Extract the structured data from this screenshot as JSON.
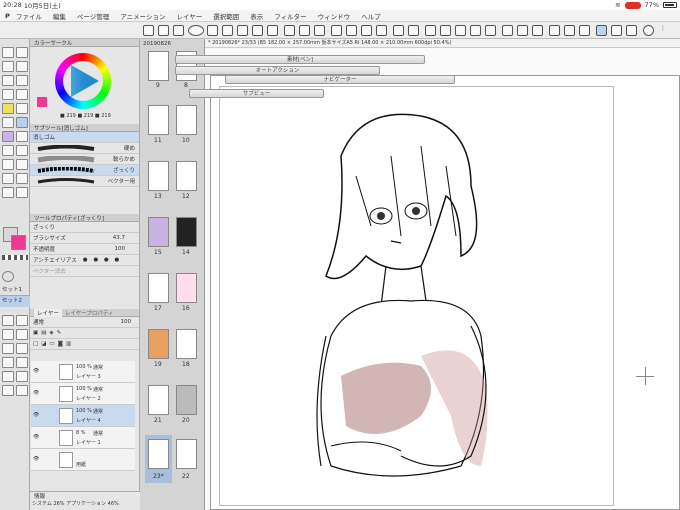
{
  "status_bar": {
    "time": "20:28",
    "date": "10月5日(土)",
    "battery": "77%"
  },
  "menu": [
    "ファイル",
    "編集",
    "ページ管理",
    "アニメーション",
    "レイヤー",
    "選択範囲",
    "表示",
    "フィルター",
    "ウィンドウ",
    "ヘルプ"
  ],
  "doc": {
    "tab": "20190826",
    "info": "* 20190826* 23/33 (B5 182.00 × 257.00mm 仮本サイズA5 Ri 148.00 × 210.00mm 600dpi 50.4%)"
  },
  "color_panel": {
    "title": "カラーサークル",
    "value": "■ 219 ■ 219 ■ 219"
  },
  "subtool": {
    "title": "サブツール[消しゴム]",
    "group": "消しゴム",
    "items": [
      "硬め",
      "軟らかめ",
      "ざっくり",
      "ベクター用"
    ]
  },
  "toolprop": {
    "title": "ツールプロパティ[ざっくり]",
    "name": "ざっくり",
    "brush_size_label": "ブラシサイズ",
    "brush_size": "43.7",
    "opacity_label": "不透明度",
    "opacity": "100",
    "antialias_label": "アンチエイリアス",
    "vector_label": "ベクター消去"
  },
  "sets": [
    "セット1",
    "セット2"
  ],
  "layers_panel": {
    "tab1": "レイヤー",
    "tab2": "レイヤープロパティ",
    "blend": "通常",
    "opacity": "100"
  },
  "layers": [
    {
      "pct": "100 %",
      "mode": "通常",
      "name": "レイヤー 3"
    },
    {
      "pct": "100 %",
      "mode": "通常",
      "name": "レイヤー 2"
    },
    {
      "pct": "100 %",
      "mode": "通常",
      "name": "レイヤー 4"
    },
    {
      "pct": "8 %",
      "mode": "通常",
      "name": "レイヤー 1"
    },
    {
      "pct": "",
      "mode": "",
      "name": "用紙"
    }
  ],
  "info_panel": {
    "tab": "情報",
    "text": "システム 26%   アプリケーション 46%"
  },
  "dialogs": [
    "素材[ペン]",
    "オートアクション",
    "ナビゲーター",
    "サブビュー"
  ],
  "pages": {
    "left": [
      "9",
      "11",
      "13",
      "15",
      "17",
      "19",
      "21",
      "23*"
    ],
    "right": [
      "8",
      "10",
      "12",
      "14",
      "16",
      "18",
      "20",
      "22"
    ]
  }
}
